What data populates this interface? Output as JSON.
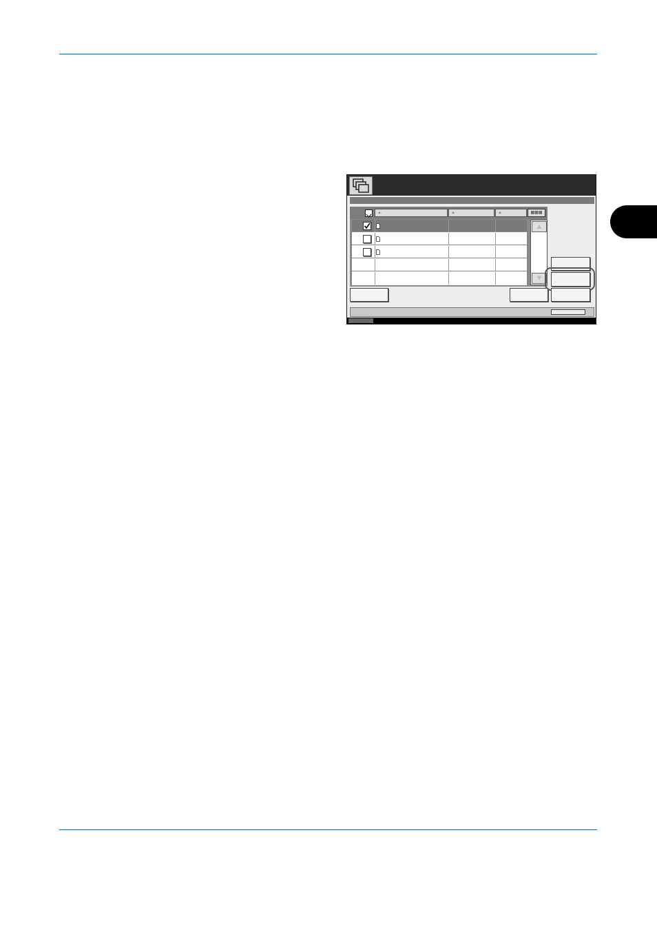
{
  "page": {
    "section_tab_color": "#000000",
    "rule_color": "#1a5fa8"
  },
  "panel": {
    "app_icon": "document-box-icon",
    "title": "",
    "list": {
      "view_toggle_icon": "thumbnail-view-icon",
      "rows": [
        {
          "checked": true,
          "selected": true,
          "icon": "document-icon"
        },
        {
          "checked": false,
          "selected": false,
          "icon": "document-icon"
        },
        {
          "checked": false,
          "selected": false,
          "icon": "document-icon"
        },
        {
          "checked": null,
          "selected": false,
          "icon": null
        },
        {
          "checked": null,
          "selected": false,
          "icon": null
        }
      ]
    },
    "scroll": {
      "up_icon": "triangle-up-icon",
      "down_icon": "triangle-down-icon"
    }
  }
}
